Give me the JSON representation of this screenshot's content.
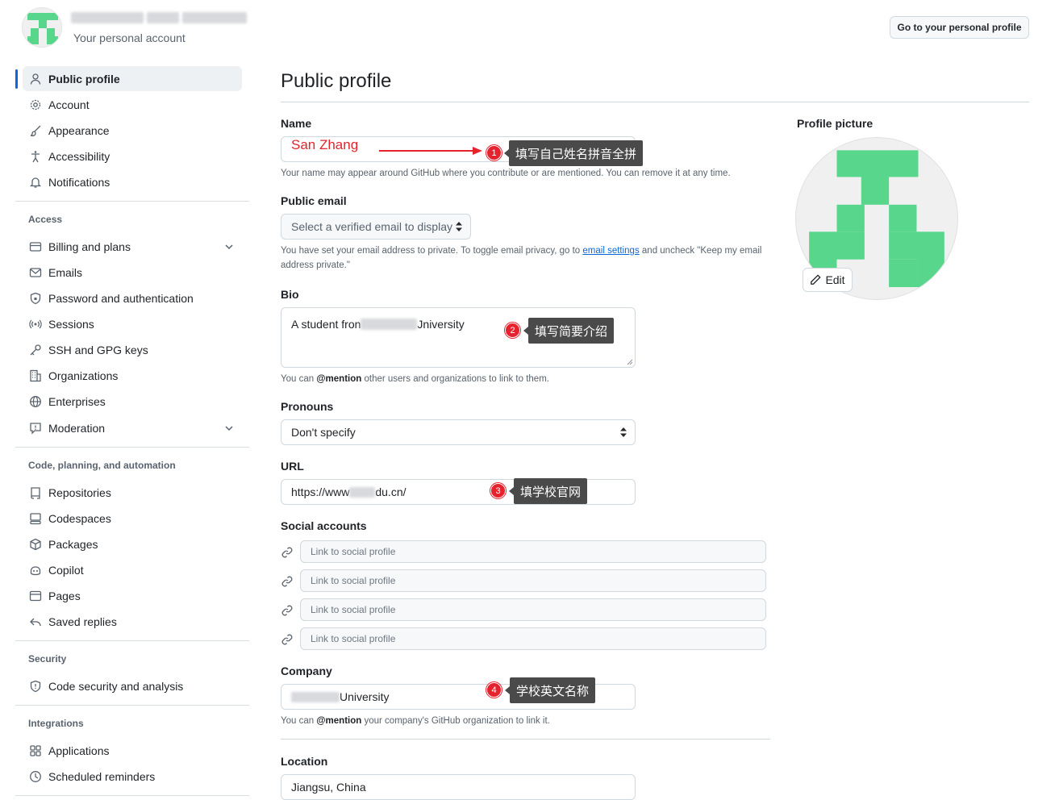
{
  "header": {
    "account_subtitle": "Your personal account",
    "go_to_profile": "Go to your personal profile"
  },
  "sidebar": {
    "top_items": [
      {
        "label": "Public profile",
        "icon": "person-icon",
        "active": true
      },
      {
        "label": "Account",
        "icon": "gear-icon"
      },
      {
        "label": "Appearance",
        "icon": "paintbrush-icon"
      },
      {
        "label": "Accessibility",
        "icon": "accessibility-icon"
      },
      {
        "label": "Notifications",
        "icon": "bell-icon"
      }
    ],
    "groups": [
      {
        "title": "Access",
        "items": [
          {
            "label": "Billing and plans",
            "icon": "credit-card-icon",
            "expandable": true
          },
          {
            "label": "Emails",
            "icon": "mail-icon"
          },
          {
            "label": "Password and authentication",
            "icon": "shield-lock-icon"
          },
          {
            "label": "Sessions",
            "icon": "broadcast-icon"
          },
          {
            "label": "SSH and GPG keys",
            "icon": "key-icon"
          },
          {
            "label": "Organizations",
            "icon": "organization-icon"
          },
          {
            "label": "Enterprises",
            "icon": "globe-icon"
          },
          {
            "label": "Moderation",
            "icon": "report-icon",
            "expandable": true
          }
        ]
      },
      {
        "title": "Code, planning, and automation",
        "items": [
          {
            "label": "Repositories",
            "icon": "repo-icon"
          },
          {
            "label": "Codespaces",
            "icon": "codespaces-icon"
          },
          {
            "label": "Packages",
            "icon": "package-icon"
          },
          {
            "label": "Copilot",
            "icon": "copilot-icon"
          },
          {
            "label": "Pages",
            "icon": "browser-icon"
          },
          {
            "label": "Saved replies",
            "icon": "reply-icon"
          }
        ]
      },
      {
        "title": "Security",
        "items": [
          {
            "label": "Code security and analysis",
            "icon": "shield-icon"
          }
        ]
      },
      {
        "title": "Integrations",
        "items": [
          {
            "label": "Applications",
            "icon": "apps-icon"
          },
          {
            "label": "Scheduled reminders",
            "icon": "clock-icon"
          }
        ]
      }
    ]
  },
  "main": {
    "title": "Public profile",
    "name": {
      "label": "Name",
      "value": "San Zhang",
      "note": "Your name may appear around GitHub where you contribute or are mentioned. You can remove it at any time."
    },
    "public_email": {
      "label": "Public email",
      "placeholder": "Select a verified email to display",
      "note_prefix": "You have set your email address to private. To toggle email privacy, go to ",
      "note_link": "email settings",
      "note_suffix": " and uncheck \"Keep my email address private.\""
    },
    "bio": {
      "label": "Bio",
      "value_prefix": "A student fron",
      "value_suffix": "Jniversity",
      "note_prefix": "You can ",
      "note_mention": "@mention",
      "note_suffix": " other users and organizations to link to them."
    },
    "pronouns": {
      "label": "Pronouns",
      "value": "Don't specify"
    },
    "url": {
      "label": "URL",
      "value_prefix": "https://www",
      "value_suffix": "du.cn/"
    },
    "social": {
      "label": "Social accounts",
      "placeholder": "Link to social profile",
      "count": 4
    },
    "company": {
      "label": "Company",
      "value_suffix": "University",
      "note_prefix": "You can ",
      "note_mention": "@mention",
      "note_suffix": " your company's GitHub organization to link it."
    },
    "location": {
      "label": "Location",
      "value": "Jiangsu, China"
    }
  },
  "profile_picture": {
    "label": "Profile picture",
    "edit": "Edit"
  },
  "annotations": [
    {
      "number": "1",
      "text": "填写自己姓名拼音全拼"
    },
    {
      "number": "2",
      "text": "填写简要介绍"
    },
    {
      "number": "3",
      "text": "填学校官网"
    },
    {
      "number": "4",
      "text": "学校英文名称"
    }
  ],
  "colors": {
    "accent": "#0969da",
    "identicon": "#57d68c",
    "annotation_red": "#e5232e"
  }
}
